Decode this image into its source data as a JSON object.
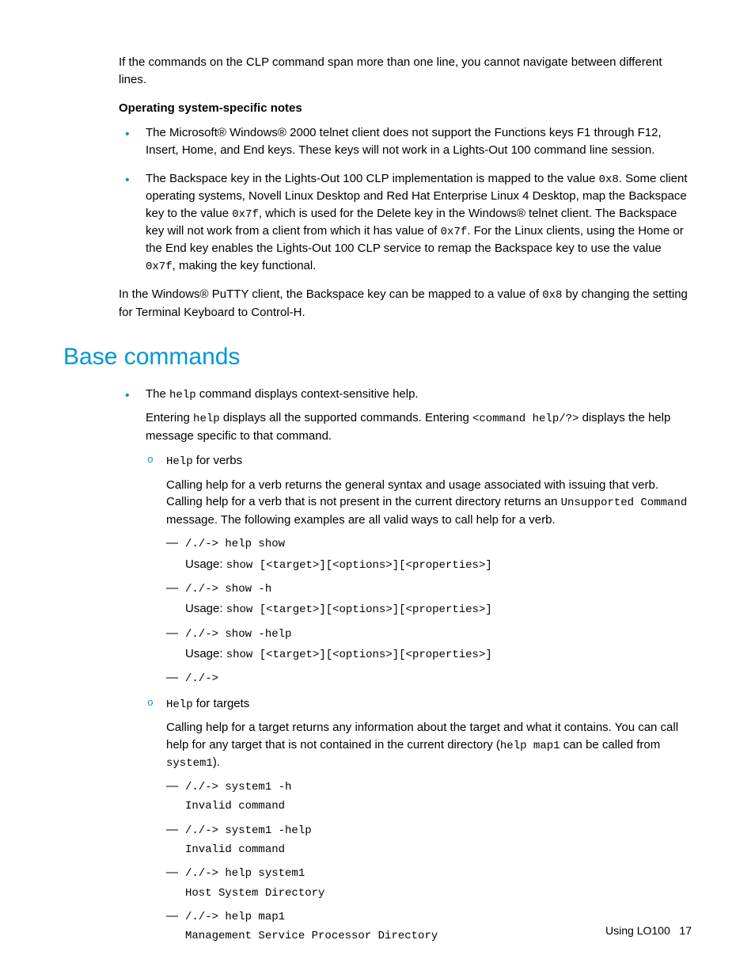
{
  "intro_para": "If the commands on the CLP command span more than one line, you cannot navigate between different lines.",
  "os_notes_heading": "Operating system-specific notes",
  "bullets": {
    "b1": "The Microsoft® Windows® 2000 telnet client does not support the Functions keys F1 through F12, Insert, Home, and End keys. These keys will not work in a Lights-Out 100 command line session.",
    "b2_pre1": "The Backspace key in the Lights-Out 100 CLP implementation is mapped to the value ",
    "b2_code1": "0x8",
    "b2_mid1": ". Some client operating systems, Novell Linux Desktop and Red Hat Enterprise Linux 4 Desktop, map the Backspace key to the value ",
    "b2_code2": "0x7f",
    "b2_mid2": ", which is used for the Delete key in the Windows® telnet client. The Backspace key will not work from a client from which it has value of ",
    "b2_code3": "0x7f",
    "b2_mid3": ". For the Linux clients, using the Home or the End key enables the Lights-Out 100 CLP service to remap the Backspace key to use the value ",
    "b2_code4": "0x7f",
    "b2_post": ", making the key functional."
  },
  "putty_pre": "In the Windows® PuTTY client, the Backspace key can be mapped to a value of ",
  "putty_code": "0x8",
  "putty_post": " by changing the setting for Terminal Keyboard to Control-H.",
  "section_heading": "Base commands",
  "base": {
    "help_pre": "The ",
    "help_code": "help",
    "help_post": " command displays context-sensitive help.",
    "entering_pre": "Entering ",
    "entering_code1": "help",
    "entering_mid": " displays all the supported commands. Entering ",
    "entering_code2": "<command help/?>",
    "entering_post": " displays the help message specific to that command.",
    "verbs_code": "Help",
    "verbs_post": " for verbs",
    "verbs_para_pre": "Calling help for a verb returns the general syntax and usage associated with issuing that verb. Calling help for a verb that is not present in the current directory returns an ",
    "verbs_para_code": "Unsupported Command",
    "verbs_para_post": " message. The following examples are all valid ways to call help for a verb.",
    "d1_cmd": "/./-> help show",
    "d1_usage_label": "Usage: ",
    "d1_usage_code": "show [<target>][<options>][<properties>]",
    "d2_cmd": "/./-> show -h",
    "d2_usage_code": "show [<target>][<options>][<properties>]",
    "d3_cmd": "/./-> show -help",
    "d3_usage_code": "show [<target>][<options>][<properties>]",
    "d4_cmd": "/./->",
    "targets_code": "Help",
    "targets_post": " for targets",
    "targets_para_pre": "Calling help for a target returns any information about the target and what it contains. You can call help for any target that is not contained in the current directory (",
    "targets_para_code1": "help map1",
    "targets_para_mid": " can be called from ",
    "targets_para_code2": "system1",
    "targets_para_post": ").",
    "t1_cmd": "/./-> system1 -h",
    "t1_out": "Invalid command",
    "t2_cmd": "/./-> system1 -help",
    "t2_out": "Invalid command",
    "t3_cmd": "/./-> help system1",
    "t3_out": "Host System Directory",
    "t4_cmd": "/./-> help map1",
    "t4_out": "Management Service Processor Directory"
  },
  "footer_text": "Using LO100",
  "footer_page": "17"
}
